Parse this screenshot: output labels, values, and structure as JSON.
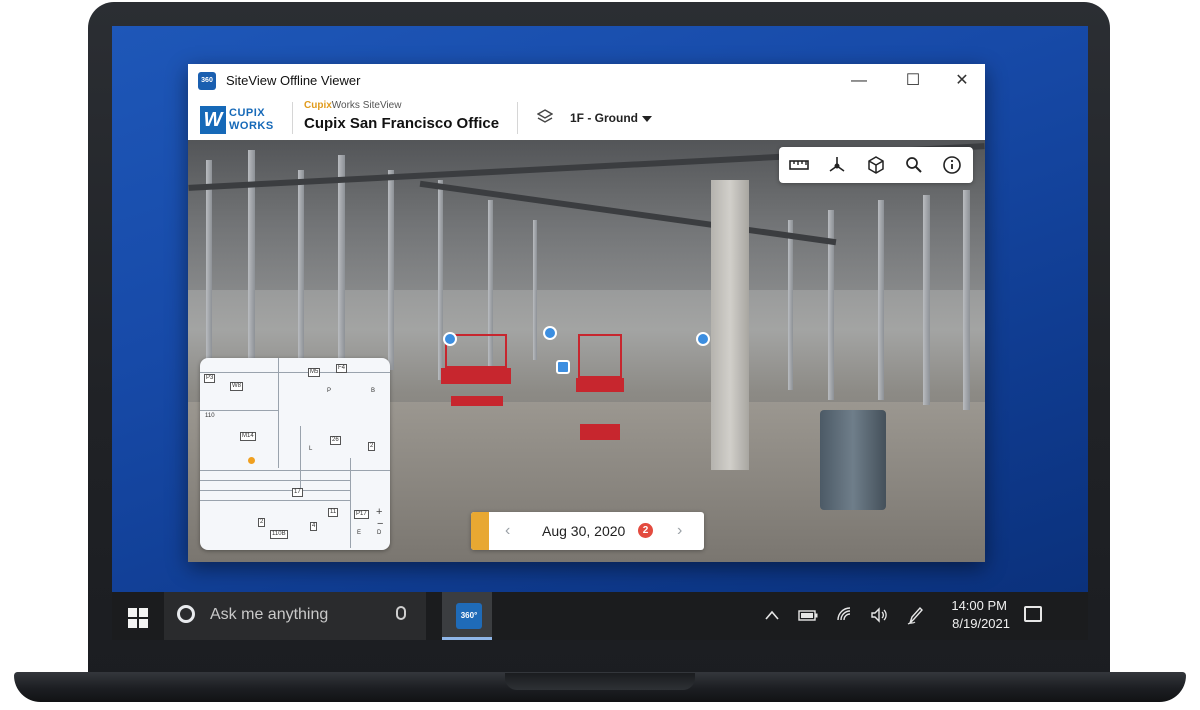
{
  "window": {
    "title": "SiteView Offline Viewer",
    "app_icon_text": "360",
    "minimize": "—",
    "maximize": "☐",
    "close": "✕"
  },
  "header": {
    "logo_line1": "CUPIX",
    "logo_line2": "WORKS",
    "logo_mark": "W",
    "brand_prefix": "Cupix",
    "brand_suffix": "Works SiteView",
    "project_name": "Cupix San Francisco Office",
    "floor_selector": "1F - Ground"
  },
  "toolbar": {
    "tools": [
      "ruler-icon",
      "3d-axis-icon",
      "box-icon",
      "zoom-search-icon",
      "info-icon"
    ]
  },
  "minimap": {
    "labels": [
      "P3",
      "W8",
      "110",
      "M14",
      "M5",
      "F4",
      "B",
      "P",
      "26",
      "2",
      "L",
      "17",
      "11",
      "4",
      "P17",
      "110B",
      "2",
      "E",
      "D"
    ],
    "zoom_in": "+",
    "zoom_out": "−"
  },
  "date_nav": {
    "prev": "‹",
    "date": "Aug 30, 2020",
    "badge": "2",
    "next": "›"
  },
  "taskbar": {
    "search_placeholder": "Ask me anything",
    "app_icon_text": "360°",
    "time": "14:00 PM",
    "date": "8/19/2021",
    "tray_icons": [
      "chevron-up-icon",
      "battery-icon",
      "wifi-icon",
      "volume-icon",
      "pen-icon"
    ]
  },
  "colors": {
    "brand_blue": "#1669b8",
    "accent_orange": "#e8a832",
    "badge_red": "#e34b3f",
    "desktop_blue": "#174aa8"
  }
}
